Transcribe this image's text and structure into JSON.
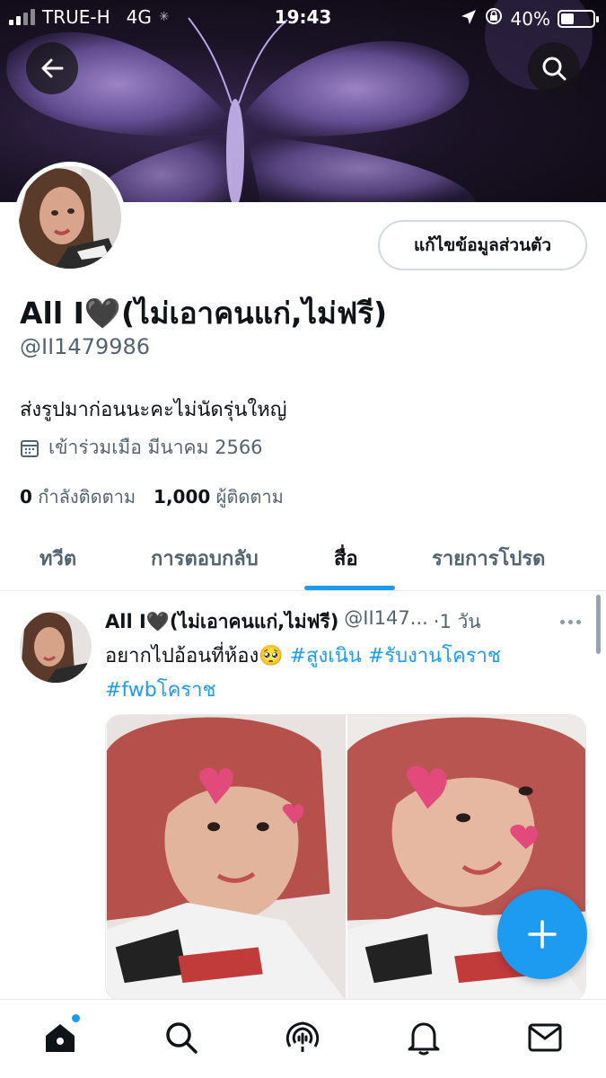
{
  "status_bar": {
    "carrier": "TRUE-H",
    "network": "4G",
    "time": "19:43",
    "battery": "40%",
    "battery_level": 0.4
  },
  "header": {
    "back_icon": "arrow-left-icon",
    "search_icon": "search-icon"
  },
  "profile": {
    "display_name": "All I🖤(ไม่เอาคนแก่,ไม่ฟรี)",
    "handle": "@II1479986",
    "bio": "ส่งรูปมาก่อนนะคะไม่นัดรุ่นใหญ่",
    "joined": "เข้าร่วมเมือ มีนาคม 2566",
    "edit_button": "แก้ไขข้อมูลส่วนตัว",
    "following_count": "0",
    "following_label": "กำลังติดตาม",
    "followers_count": "1,000",
    "followers_label": "ผู้ติดตาม"
  },
  "tabs": [
    {
      "label": "ทวีต",
      "active": false
    },
    {
      "label": "การตอบกลับ",
      "active": false
    },
    {
      "label": "สื่อ",
      "active": true
    },
    {
      "label": "รายการโปรด",
      "active": false
    }
  ],
  "tweet": {
    "name": "All I🖤(ไม่เอาคนแก่,ไม่ฟรี)",
    "handle": "@II147...",
    "time": "·1 วัน",
    "text": "อยากไปอ้อนที่ห้อง🥺",
    "hashtags": [
      "#สูงเนิน",
      "#รับงานโคราช",
      "#fwbโคราช"
    ]
  },
  "colors": {
    "accent": "#1d9bf0",
    "text_primary": "#0f1419",
    "text_secondary": "#536471"
  },
  "bottom_nav": [
    {
      "icon": "home-icon",
      "active": true
    },
    {
      "icon": "search-icon",
      "active": false
    },
    {
      "icon": "spaces-icon",
      "active": false
    },
    {
      "icon": "bell-icon",
      "active": false
    },
    {
      "icon": "mail-icon",
      "active": false
    }
  ],
  "fab_icon": "plus-icon"
}
